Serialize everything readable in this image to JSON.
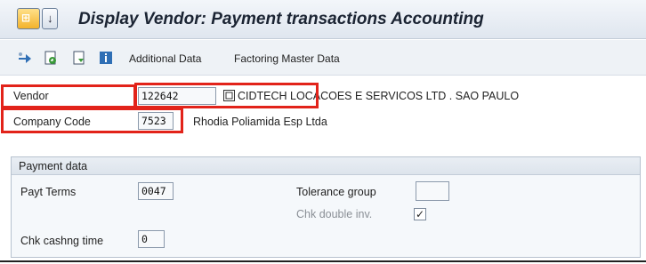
{
  "window": {
    "title": "Display Vendor: Payment transactions Accounting"
  },
  "toolbar": {
    "icons": [
      "other-vendor-icon",
      "display-change-icon",
      "create-document-icon",
      "information-icon"
    ],
    "additional_data": "Additional Data",
    "factoring_master_data": "Factoring Master Data"
  },
  "header": {
    "vendor_label": "Vendor",
    "vendor_value": "122642",
    "vendor_name": "CIDTECH LOCACOES E SERVICOS LTD .  SAO PAULO",
    "company_code_label": "Company Code",
    "company_code_value": "7523",
    "company_name": "Rhodia Poliamida Esp Ltda"
  },
  "payment_data": {
    "title": "Payment data",
    "payt_terms_label": "Payt Terms",
    "payt_terms_value": "0047",
    "tolerance_group_label": "Tolerance group",
    "tolerance_group_value": "",
    "chk_double_inv_label": "Chk double inv.",
    "chk_double_inv_checked": true,
    "chk_double_inv_mark": "✓",
    "chk_cashing_time_label": "Chk cashng time",
    "chk_cashing_time_value": "0"
  },
  "colors": {
    "highlight": "#e2231a",
    "title_bar": "#dfe6ef"
  }
}
